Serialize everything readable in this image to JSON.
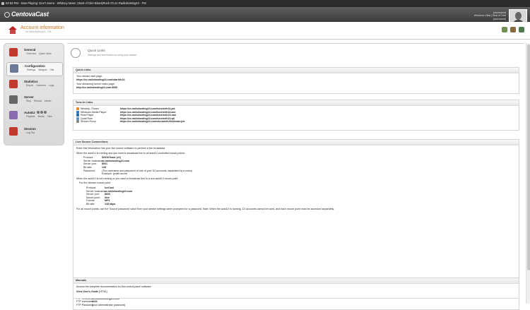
{
  "now_playing": "02:53 PM - Now Playing: Don't Seem - Whitney Mann | Best of Dire Blues|Rock #3 on Radiohosting24 - FM",
  "brand": "CentovaCast",
  "user": {
    "line1": "[username]",
    "line2": "Windows Vista | Best of Dire",
    "line3": "[username]"
  },
  "account": {
    "title": "Account information",
    "subtitle": "for Radiohosting24 - FM"
  },
  "sidebar": [
    {
      "title": "General",
      "subs": [
        "Overview",
        "Quick Links"
      ],
      "icon": "house-icon",
      "color": "#c0392b"
    },
    {
      "title": "Configuration",
      "subs": [
        "Settings",
        "Widgets",
        "Hits"
      ],
      "icon": "config-icon",
      "color": "#6b7a99"
    },
    {
      "title": "Statistics",
      "subs": [
        "Report",
        "Listeners",
        "Logs"
      ],
      "icon": "stats-icon",
      "color": "#c0392b"
    },
    {
      "title": "Server",
      "subs": [
        "Stop",
        "Reload",
        "Admin"
      ],
      "icon": "server-icon",
      "color": "#666666"
    },
    {
      "title": "AutoDJ",
      "subs": [
        "Playlists",
        "Media",
        "Files"
      ],
      "icon": "autodj-icon",
      "color": "#8a6bb0"
    },
    {
      "title": "Session",
      "subs": [
        "Log Out"
      ],
      "icon": "logout-x-icon",
      "color": "#c0392b"
    }
  ],
  "quick": {
    "title": "Quick Links",
    "subtitle": "Settings and information for using your stream"
  },
  "p1": {
    "title": "Quick Links",
    "l1": "Your stream start page:",
    "v1": "https://cc.radiohosting24.com/start/rh24",
    "l2": "Your streaming server video page:",
    "v2": "http://cc.radiohosting24.com:8000"
  },
  "p2": {
    "title": "Tune-In Links",
    "rows": [
      {
        "name": "Winamp, iTunes",
        "url": "https://cc.radiohosting24.com/tunein/rh24.pls",
        "color": "#e08a1e"
      },
      {
        "name": "Windows Media Player",
        "url": "https://cc.radiohosting24.com/tunein/rh24.asx",
        "color": "#2b7bc8"
      },
      {
        "name": "Real Player",
        "url": "https://cc.radiohosting24.com/tunein/rh24.ram",
        "color": "#1f6fb0"
      },
      {
        "name": "QuickTime",
        "url": "https://cc.radiohosting24.com/tunein/rh24.qtl",
        "color": "#5a8fd0"
      },
      {
        "name": "Stream Proxy",
        "url": "https://cc.radiohosting24.com/stream/rh24/stream.pls",
        "color": "#888888"
      }
    ]
  },
  "p3": {
    "title": "Live Source Connections",
    "intro": "Enter this information into your live source software to perform a live broadcast.",
    "when_running": "When the autoDJ is running and you want to broadcast live to all autoDJ controlled mount points:",
    "k1": [
      {
        "k": "Protocol:",
        "v": "SHOUTcast (v1)"
      },
      {
        "k": "Server hostname:",
        "v": "cc.radiohosting24.com"
      },
      {
        "k": "Server port:",
        "v": "8001"
      },
      {
        "k": "Bit rate:",
        "v": "128"
      },
      {
        "k": "Password:",
        "v": "(The username and password of one of your DJ accounts, separated by a colon)"
      }
    ],
    "example": "Example: jsmith:secret",
    "when_not": "When the autoDJ is not running or you want to broadcast live to a non-autoDJ mount point:",
    "for_mount": "For the /stream mount point:",
    "k2": [
      {
        "k": "Protocol:",
        "v": "IceCast"
      },
      {
        "k": "Server hostname:",
        "v": "cc.radiohosting24.com"
      },
      {
        "k": "Server port:",
        "v": "8000"
      },
      {
        "k": "Mount point:",
        "v": "/live"
      },
      {
        "k": "Format:",
        "v": "MP3"
      },
      {
        "k": "Bit rate:",
        "v": "128 kbps"
      }
    ],
    "footer": "For all mount points, use the 'Source password' value from your stream settings when prompted for a password. Note: When the autoDJ is running, DJ accounts cannot be used, and each mount point must be accessed separately."
  },
  "p4": {
    "title": "FTP Client Connections",
    "intro": "Enter this information into your FTP client software to upload your media for the autoDJ:",
    "k": [
      {
        "k": "FTP Hostname:",
        "v": "cc.radiohosting24.com"
      },
      {
        "k": "FTP Username:",
        "v": "rh24"
      },
      {
        "k": "FTP Password:",
        "v": "[your administrator password]"
      }
    ]
  },
  "p5": {
    "title": "Manuals",
    "intro": "Access the complete documentation for this control panel software:",
    "link": "View User's Guide",
    "link_suffix": "[HTML]"
  }
}
